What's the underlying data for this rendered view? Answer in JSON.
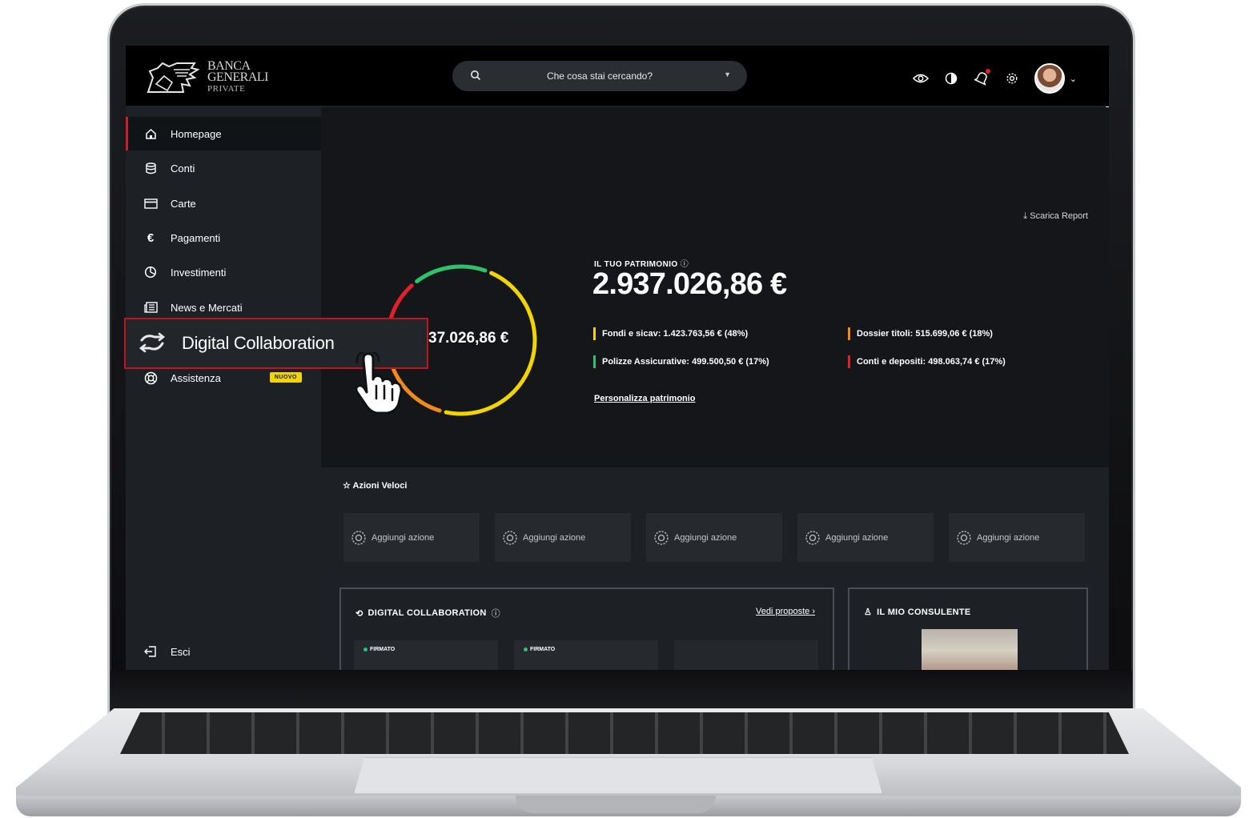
{
  "brand": {
    "line1": "BANCA",
    "line2": "GENERALI",
    "line3": "PRIVATE"
  },
  "search": {
    "placeholder": "Che cosa stai cercando?"
  },
  "header_icons": [
    "eye-icon",
    "contrast-icon",
    "bell-icon",
    "gear-icon"
  ],
  "sidebar": {
    "items": [
      {
        "label": "Homepage",
        "icon": "home-icon"
      },
      {
        "label": "Conti",
        "icon": "database-icon"
      },
      {
        "label": "Carte",
        "icon": "card-icon"
      },
      {
        "label": "Pagamenti",
        "icon": "euro-icon"
      },
      {
        "label": "Investimenti",
        "icon": "pie-chart-icon"
      },
      {
        "label": "News e Mercati",
        "icon": "newspaper-icon"
      },
      {
        "label": "Assistenza",
        "icon": "lifebuoy-icon",
        "badge": "NUOVO"
      }
    ],
    "callout": {
      "label": "Digital Collaboration",
      "icon": "handshake-icon"
    },
    "logout": "Esci"
  },
  "hero": {
    "download": "Scarica Report",
    "donut_value": "37.026,86 €",
    "patrimonio_label": "IL TUO PATRIMONIO",
    "patrimonio_value": "2.937.026,86 €",
    "breakdown": [
      {
        "text": "Fondi e sicav: 1.423.763,56 € (48%)",
        "color": "#f2d400",
        "share": 0.48
      },
      {
        "text": "Polizze Assicurative: 499.500,50 € (17%)",
        "color": "#2fc16b",
        "share": 0.17
      },
      {
        "text": "Dossier titoli: 515.699,06 € (18%)",
        "color": "#f08a1c",
        "share": 0.18
      },
      {
        "text": "Conti e depositi: 498.063,74 € (17%)",
        "color": "#e0202a",
        "share": 0.17
      }
    ],
    "personalizza": "Personalizza patrimonio"
  },
  "azioni_veloci": {
    "title": "Azioni Veloci",
    "cards": [
      "Aggiungi azione",
      "Aggiungi azione",
      "Aggiungi azione",
      "Aggiungi azione",
      "Aggiungi azione"
    ]
  },
  "digital_collaboration": {
    "title": "DIGITAL COLLABORATION",
    "link": "Vedi proposte",
    "cards": [
      {
        "status": "FIRMATO"
      },
      {
        "status": "FIRMATO"
      }
    ]
  },
  "consulente": {
    "title": "IL MIO CONSULENTE"
  }
}
